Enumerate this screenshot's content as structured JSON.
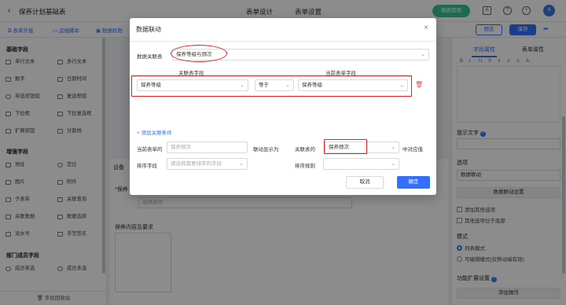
{
  "header": {
    "back_glyph": "‹",
    "app_title": "保养计划基础表",
    "tabs": [
      {
        "label": "表单设计"
      },
      {
        "label": "表单设置"
      }
    ],
    "data_mgmt": "数据管理",
    "avatar_text": "6"
  },
  "toolbar2": {
    "items": [
      {
        "label": "表单外链"
      },
      {
        "label": "运维脚本"
      },
      {
        "label": "数据权限"
      }
    ],
    "preview": "预览",
    "save": "保存"
  },
  "left": {
    "groups": [
      {
        "title": "基础字段"
      },
      {
        "title": "增强字段"
      },
      {
        "title": "部门成员字段"
      }
    ],
    "fields": [
      "单行文本",
      "多行文本",
      "数字",
      "日期时间",
      "单选按钮组",
      "复选框组",
      "下拉框",
      "下拉复选框",
      "扩展按钮",
      "分割线",
      "地址",
      "定位",
      "图片",
      "附件",
      "子表单",
      "关联查询",
      "关联数据",
      "数据选择",
      "流水号",
      "手写签名",
      "成员单选",
      "成员多选"
    ],
    "recycle": "字段回收站"
  },
  "canvas": {
    "section_label": "设备",
    "field1_label": "*保养",
    "select_placeholder": "选择选项",
    "field2_label": "保养内容及要求"
  },
  "right": {
    "tabs": [
      {
        "label": "字段属性"
      },
      {
        "label": "表单属性"
      }
    ],
    "editor_tools": [
      "B",
      "I",
      "U",
      "S",
      "≡",
      "≡",
      "≡",
      "A"
    ],
    "hint_label": "提示文字",
    "options_label": "选项",
    "options_value": "数据联动",
    "linkage_btn": "数据联动设置",
    "check1": "添加其他选项",
    "check2": "其他选项位于底部",
    "mode_label": "模式",
    "radio1": "列表模式",
    "radio2": "可编辑模式(仅移动端有效)",
    "ext_label": "功能扩展设置",
    "add_action": "添加操作"
  },
  "modal": {
    "title": "数据联动",
    "close": "×",
    "link_table_label": "数据关联表",
    "link_table_value": "保养等级与频次",
    "col_link_field": "关联表字段",
    "col_cur_field": "当前表单字段",
    "row": {
      "left_field": "保养等级",
      "op": "等于",
      "right_field": "保养等级"
    },
    "add_condition": "+ 添加关联条件",
    "current_form_label": "当前表单的",
    "current_form_value": "保养频次",
    "display_as": "联动显示为",
    "link_table_of": "关联表的",
    "link_table_field": "保养频次",
    "corresponds": "中对应值",
    "sort_field_label": "排序字段",
    "sort_field_placeholder": "请选择需要排序的字段",
    "sort_rule_label": "排序规则",
    "cancel": "取消",
    "ok": "确定"
  },
  "colors": {
    "accent": "#3370ff",
    "highlight": "#e02020",
    "success": "#34c38f"
  }
}
